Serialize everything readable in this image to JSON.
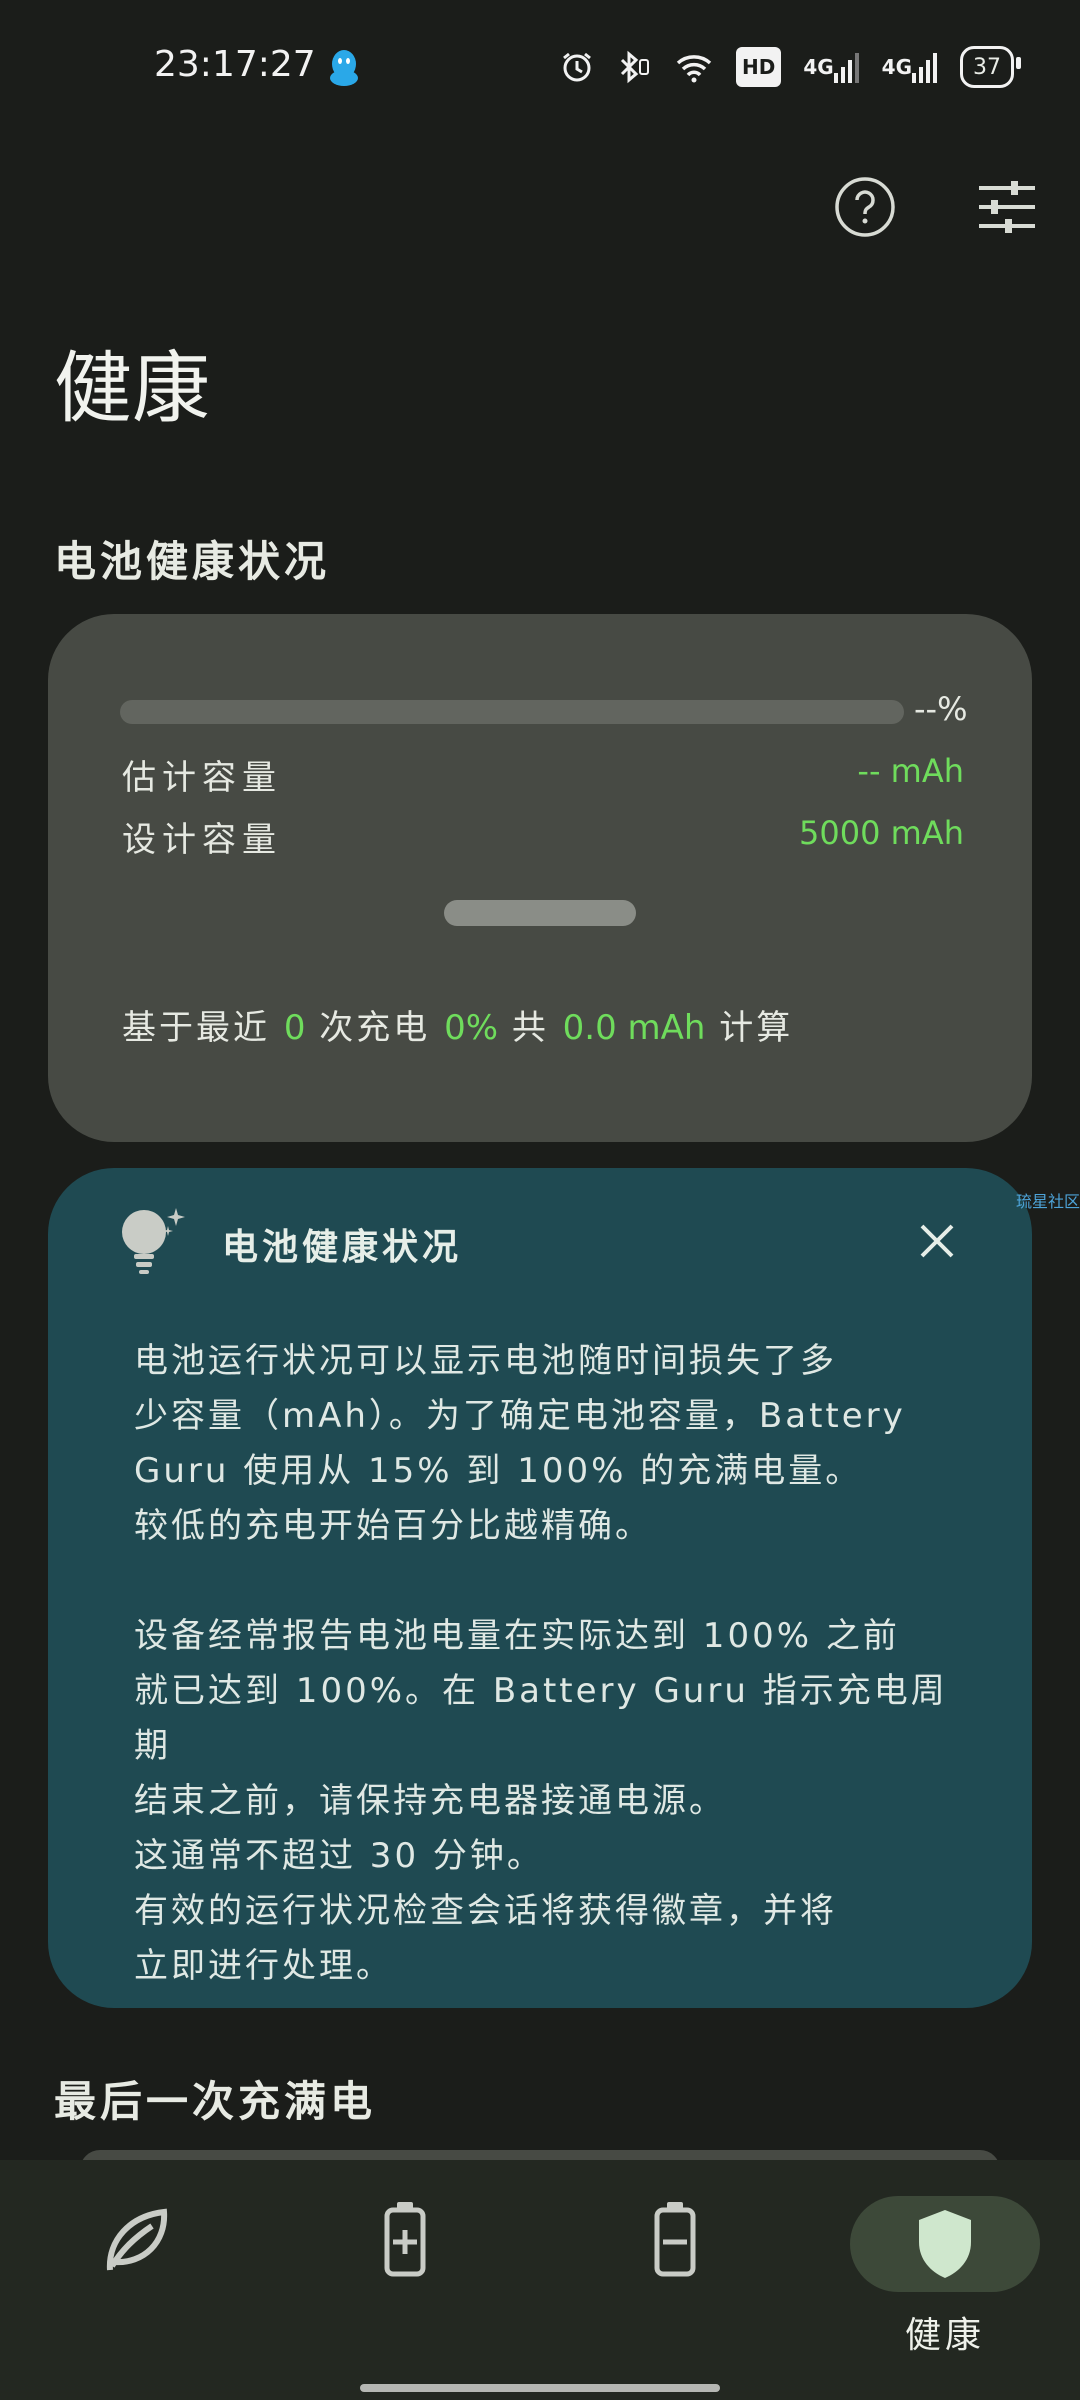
{
  "status_bar": {
    "time": "23:17:27",
    "hd_label": "HD",
    "net1": "4G",
    "net2": "4G",
    "battery": "37"
  },
  "page": {
    "title": "健康"
  },
  "health_section": {
    "heading": "电池健康状况",
    "progress_fraction": 0,
    "percent_label": "--%",
    "estimated_label": "估计容量",
    "estimated_value": "-- mAh",
    "design_label": "设计容量",
    "design_value": "5000 mAh",
    "basis": {
      "prefix": "基于最近",
      "count": "0",
      "mid": "次充电",
      "percent": "0%",
      "join": "共",
      "amount": "0.0 mAh",
      "suffix": "计算"
    }
  },
  "info_card": {
    "title": "电池健康状况",
    "paragraph1": "电池运行状况可以显示电池随时间损失了多\n少容量（mAh）。为了确定电池容量，Battery\nGuru 使用从 15% 到 100% 的充满电量。\n较低的充电开始百分比越精确。",
    "paragraph2": "设备经常报告电池电量在实际达到 100% 之前\n就已达到 100%。在 Battery Guru 指示充电周期\n结束之前，请保持充电器接通电源。\n这通常不超过 30 分钟。\n有效的运行状况检查会话将获得徽章，并将\n立即进行处理。"
  },
  "side_link": "琉星社区",
  "last_full": {
    "heading": "最后一次充满电"
  },
  "bottom_nav": {
    "active_label": "健康"
  },
  "colors": {
    "accent_green": "#6fdc5c",
    "background": "#1b1d1a",
    "card": "#474a44",
    "info_card": "#1f4a52"
  }
}
